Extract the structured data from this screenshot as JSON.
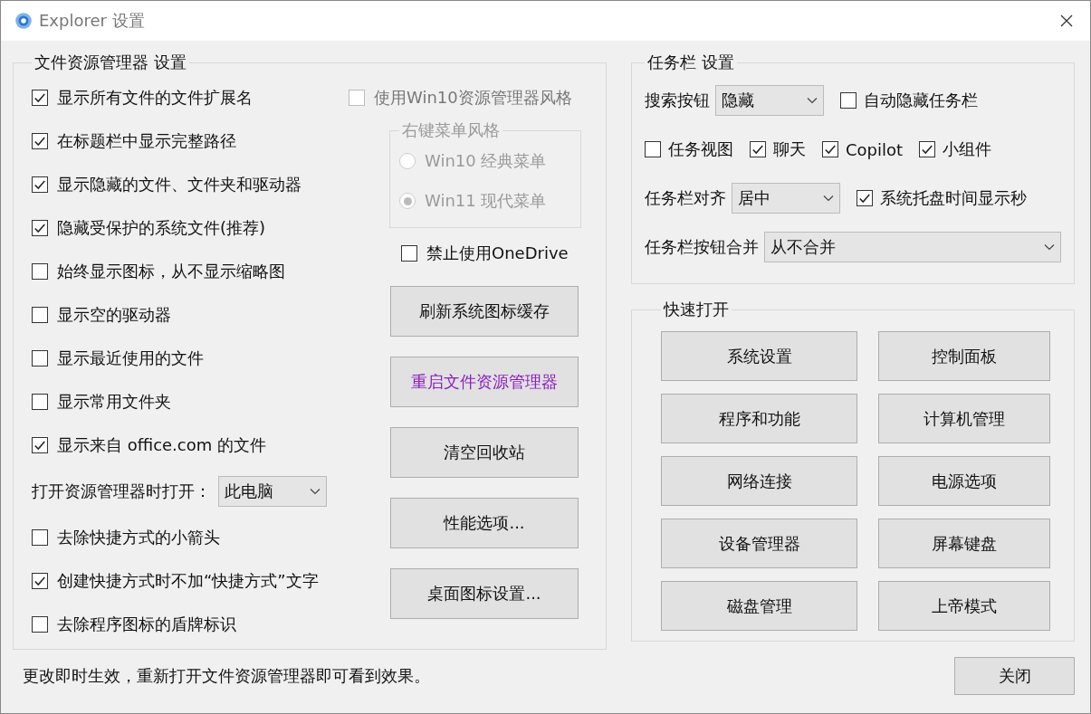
{
  "window": {
    "title": "Explorer 设置"
  },
  "explorer_settings": {
    "title": "文件资源管理器 设置",
    "options": [
      {
        "kind": "checkbox",
        "label": "显示所有文件的文件扩展名",
        "checked": true
      },
      {
        "kind": "checkbox",
        "label": "在标题栏中显示完整路径",
        "checked": true
      },
      {
        "kind": "checkbox",
        "label": "显示隐藏的文件、文件夹和驱动器",
        "checked": true
      },
      {
        "kind": "checkbox",
        "label": "隐藏受保护的系统文件(推荐)",
        "checked": true
      },
      {
        "kind": "checkbox",
        "label": "始终显示图标，从不显示缩略图",
        "checked": false
      },
      {
        "kind": "checkbox",
        "label": "显示空的驱动器",
        "checked": false
      },
      {
        "kind": "checkbox",
        "label": "显示最近使用的文件",
        "checked": false
      },
      {
        "kind": "checkbox",
        "label": "显示常用文件夹",
        "checked": false
      },
      {
        "kind": "checkbox",
        "label": "显示来自 office.com 的文件",
        "checked": true
      },
      {
        "kind": "dropdown",
        "label": "打开资源管理器时打开：",
        "value": "此电脑"
      },
      {
        "kind": "checkbox",
        "label": "去除快捷方式的小箭头",
        "checked": false
      },
      {
        "kind": "checkbox",
        "label": "创建快捷方式时不加“快捷方式”文字",
        "checked": true
      },
      {
        "kind": "checkbox",
        "label": "去除程序图标的盾牌标识",
        "checked": false
      }
    ],
    "win10_style": {
      "label": "使用Win10资源管理器风格",
      "checked": false,
      "disabled": true
    },
    "context_menu": {
      "title": "右键菜单风格",
      "disabled": true,
      "options": [
        {
          "label": "Win10 经典菜单",
          "selected": false
        },
        {
          "label": "Win11 现代菜单",
          "selected": true
        }
      ]
    },
    "disable_onedrive": {
      "label": "禁止使用OneDrive",
      "checked": false
    },
    "buttons": [
      {
        "label": "刷新系统图标缓存",
        "highlight": false
      },
      {
        "label": "重启文件资源管理器",
        "highlight": true
      },
      {
        "label": "清空回收站",
        "highlight": false
      },
      {
        "label": "性能选项...",
        "highlight": false
      },
      {
        "label": "桌面图标设置...",
        "highlight": false
      }
    ]
  },
  "taskbar_settings": {
    "title": "任务栏 设置",
    "rows": [
      [
        {
          "kind": "dropdown",
          "label": "搜索按钮",
          "value": "隐藏"
        },
        {
          "kind": "checkbox",
          "label": "自动隐藏任务栏",
          "checked": false
        }
      ],
      [
        {
          "kind": "checkbox",
          "label": "任务视图",
          "checked": false
        },
        {
          "kind": "checkbox",
          "label": "聊天",
          "checked": true
        },
        {
          "kind": "checkbox",
          "label": "Copilot",
          "checked": true
        },
        {
          "kind": "checkbox",
          "label": "小组件",
          "checked": true
        }
      ],
      [
        {
          "kind": "dropdown",
          "label": "任务栏对齐",
          "value": "居中"
        },
        {
          "kind": "checkbox",
          "label": "系统托盘时间显示秒",
          "checked": true
        }
      ],
      [
        {
          "kind": "dropdown",
          "label": "任务栏按钮合并",
          "value": "从不合并"
        }
      ]
    ]
  },
  "quick_open": {
    "title": "快速打开",
    "buttons": [
      "系统设置",
      "控制面板",
      "程序和功能",
      "计算机管理",
      "网络连接",
      "电源选项",
      "设备管理器",
      "屏幕键盘",
      "磁盘管理",
      "上帝模式"
    ]
  },
  "status_text": "更改即时生效，重新打开文件资源管理器即可看到效果。",
  "close_button": "关闭"
}
